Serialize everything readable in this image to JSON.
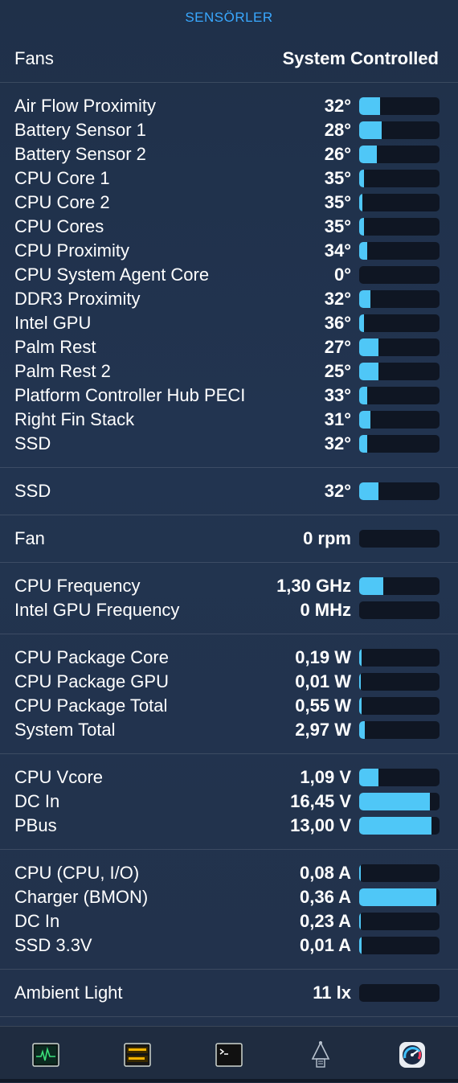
{
  "header": {
    "title": "SENSÖRLER"
  },
  "fans": {
    "label": "Fans",
    "value": "System Controlled"
  },
  "sections": [
    {
      "name": "temperatures",
      "rows": [
        {
          "label": "Air Flow Proximity",
          "value": "32°",
          "level": 0.26
        },
        {
          "label": "Battery Sensor 1",
          "value": "28°",
          "level": 0.28
        },
        {
          "label": "Battery Sensor 2",
          "value": "26°",
          "level": 0.22
        },
        {
          "label": "CPU Core 1",
          "value": "35°",
          "level": 0.06
        },
        {
          "label": "CPU Core 2",
          "value": "35°",
          "level": 0.04
        },
        {
          "label": "CPU Cores",
          "value": "35°",
          "level": 0.06
        },
        {
          "label": "CPU Proximity",
          "value": "34°",
          "level": 0.1
        },
        {
          "label": "CPU System Agent Core",
          "value": "0°",
          "level": 0
        },
        {
          "label": "DDR3 Proximity",
          "value": "32°",
          "level": 0.14
        },
        {
          "label": "Intel GPU",
          "value": "36°",
          "level": 0.06
        },
        {
          "label": "Palm Rest",
          "value": "27°",
          "level": 0.24
        },
        {
          "label": "Palm Rest 2",
          "value": "25°",
          "level": 0.24
        },
        {
          "label": "Platform Controller Hub PECI",
          "value": "33°",
          "level": 0.1
        },
        {
          "label": "Right Fin Stack",
          "value": "31°",
          "level": 0.14
        },
        {
          "label": "SSD",
          "value": "32°",
          "level": 0.1
        }
      ]
    },
    {
      "name": "ssd",
      "rows": [
        {
          "label": "SSD",
          "value": "32°",
          "level": 0.24
        }
      ]
    },
    {
      "name": "fan",
      "rows": [
        {
          "label": "Fan",
          "value": "0 rpm",
          "level": 0
        }
      ]
    },
    {
      "name": "frequency",
      "rows": [
        {
          "label": "CPU Frequency",
          "value": "1,30 GHz",
          "level": 0.3
        },
        {
          "label": "Intel GPU Frequency",
          "value": "0 MHz",
          "level": 0
        }
      ]
    },
    {
      "name": "power",
      "rows": [
        {
          "label": "CPU Package Core",
          "value": "0,19 W",
          "level": 0.03
        },
        {
          "label": "CPU Package GPU",
          "value": "0,01 W",
          "level": 0.02
        },
        {
          "label": "CPU Package Total",
          "value": "0,55 W",
          "level": 0.03
        },
        {
          "label": "System Total",
          "value": "2,97 W",
          "level": 0.07
        }
      ]
    },
    {
      "name": "voltage",
      "rows": [
        {
          "label": "CPU Vcore",
          "value": "1,09 V",
          "level": 0.24
        },
        {
          "label": "DC In",
          "value": "16,45 V",
          "level": 0.88
        },
        {
          "label": "PBus",
          "value": "13,00 V",
          "level": 0.9
        }
      ]
    },
    {
      "name": "current",
      "rows": [
        {
          "label": "CPU (CPU, I/O)",
          "value": "0,08 A",
          "level": 0.02
        },
        {
          "label": "Charger (BMON)",
          "value": "0,36 A",
          "level": 0.96
        },
        {
          "label": "DC In",
          "value": "0,23 A",
          "level": 0.02
        },
        {
          "label": "SSD 3.3V",
          "value": "0,01 A",
          "level": 0.03
        }
      ]
    },
    {
      "name": "light",
      "rows": [
        {
          "label": "Ambient Light",
          "value": "11 lx",
          "level": 0
        }
      ]
    }
  ],
  "toolbar": [
    {
      "name": "activity-monitor-icon"
    },
    {
      "name": "console-icon"
    },
    {
      "name": "terminal-icon"
    },
    {
      "name": "system-information-icon"
    },
    {
      "name": "istat-menus-icon"
    }
  ],
  "colors": {
    "accent": "#39a8ff",
    "bar_fill": "#4fc7f7",
    "bar_track": "#0f1623",
    "background": "#22324b"
  }
}
